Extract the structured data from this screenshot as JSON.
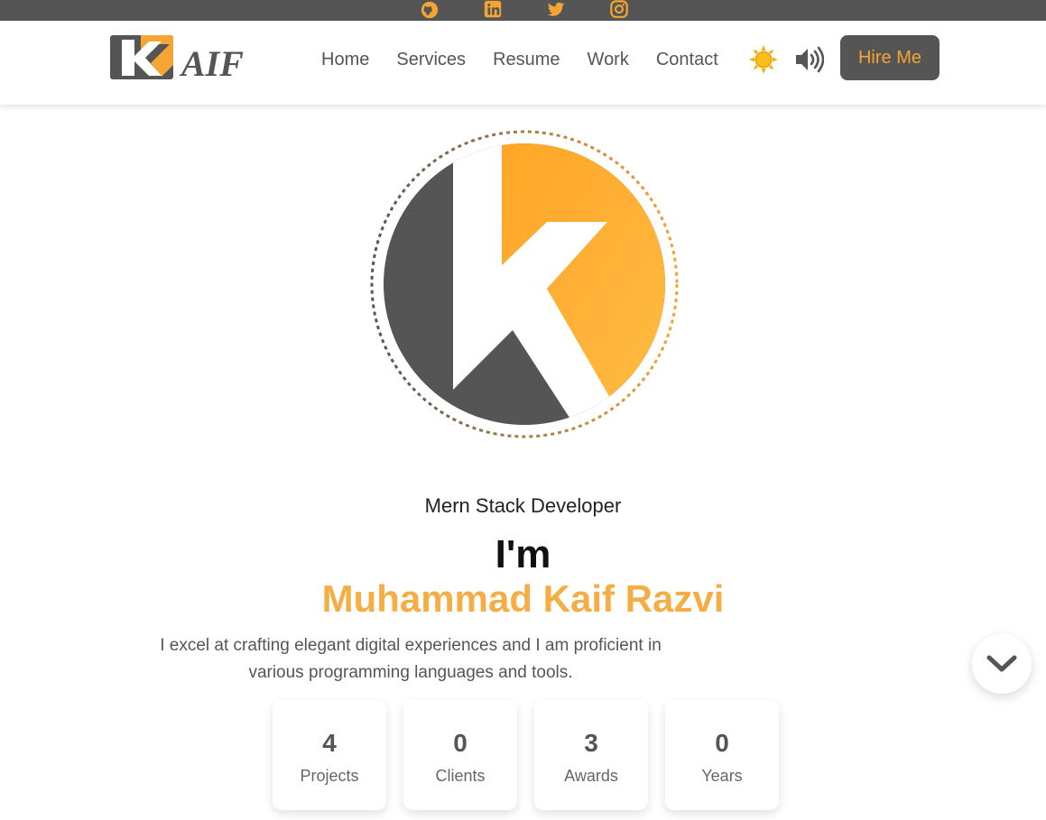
{
  "colors": {
    "accent": "#f5a533",
    "dark": "#555555",
    "background": "#ffffff"
  },
  "social": [
    {
      "icon": "github-icon"
    },
    {
      "icon": "linkedin-icon"
    },
    {
      "icon": "twitter-icon"
    },
    {
      "icon": "instagram-icon"
    }
  ],
  "header": {
    "logo_text": "AIF",
    "nav": [
      "Home",
      "Services",
      "Resume",
      "Work",
      "Contact"
    ],
    "theme_icon": "sun-icon",
    "sound_icon": "volume-icon",
    "hire_label": "Hire Me"
  },
  "hero": {
    "role": "Mern Stack Developer",
    "intro": "I'm",
    "name": "Muhammad Kaif Razvi",
    "description": "I excel at crafting elegant digital experiences and I am proficient in various programming languages and tools."
  },
  "stats": [
    {
      "value": "4",
      "label": "Projects"
    },
    {
      "value": "0",
      "label": "Clients"
    },
    {
      "value": "3",
      "label": "Awards"
    },
    {
      "value": "0",
      "label": "Years"
    }
  ],
  "scroll_icon": "chevron-down-icon"
}
